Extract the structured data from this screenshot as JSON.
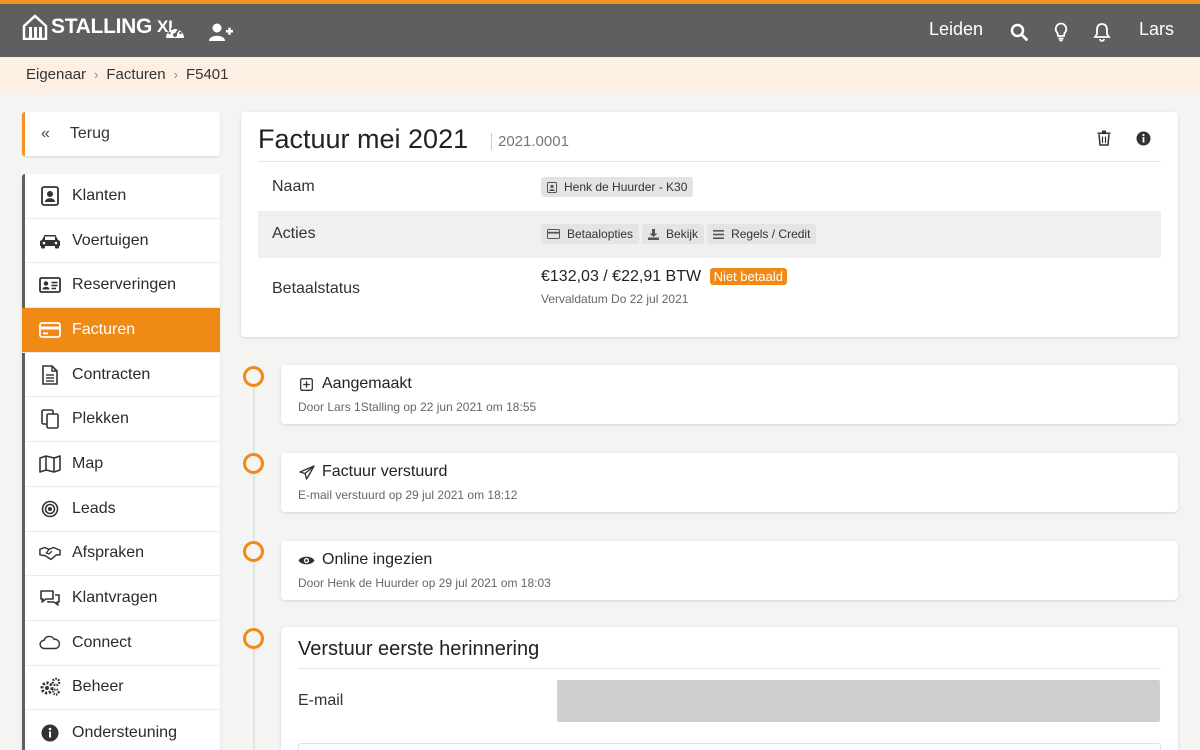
{
  "app": {
    "logo_text": "STALLING",
    "logo_suffix": "XL"
  },
  "topbar": {
    "location": "Leiden",
    "user": "Lars"
  },
  "breadcrumb": [
    "Eigenaar",
    "Facturen",
    "F5401"
  ],
  "sidebar": {
    "back_label": "Terug",
    "items": [
      {
        "label": "Klanten",
        "icon": "contact-card-icon"
      },
      {
        "label": "Voertuigen",
        "icon": "car-icon"
      },
      {
        "label": "Reserveringen",
        "icon": "id-card-icon"
      },
      {
        "label": "Facturen",
        "icon": "credit-card-icon",
        "active": true
      },
      {
        "label": "Contracten",
        "icon": "document-icon"
      },
      {
        "label": "Plekken",
        "icon": "copy-icon"
      },
      {
        "label": "Map",
        "icon": "map-icon"
      },
      {
        "label": "Leads",
        "icon": "target-icon"
      },
      {
        "label": "Afspraken",
        "icon": "handshake-icon"
      },
      {
        "label": "Klantvragen",
        "icon": "chat-icon"
      },
      {
        "label": "Connect",
        "icon": "cloud-icon"
      },
      {
        "label": "Beheer",
        "icon": "gears-icon"
      },
      {
        "label": "Ondersteuning",
        "icon": "info-icon"
      }
    ]
  },
  "invoice": {
    "title": "Factuur mei 2021",
    "number": "2021.0001",
    "rows": {
      "name_label": "Naam",
      "name_value": "Henk de Huurder - K30",
      "actions_label": "Acties",
      "actions": [
        "Betaalopties",
        "Bekijk",
        "Regels / Credit"
      ],
      "status_label": "Betaalstatus",
      "amount": "€132,03 / €22,91 BTW",
      "status_badge": "Niet betaald",
      "due": "Vervaldatum Do 22 jul 2021"
    }
  },
  "timeline": [
    {
      "title": "Aangemaakt",
      "subtitle": "Door Lars 1Stalling op 22 jun 2021 om 18:55",
      "icon": "plus-square-icon"
    },
    {
      "title": "Factuur verstuurd",
      "subtitle": "E-mail verstuurd op 29 jul 2021 om 18:12",
      "icon": "paper-plane-icon"
    },
    {
      "title": "Online ingezien",
      "subtitle": "Door Henk de Huurder op 29 jul 2021 om 18:03",
      "icon": "eye-icon"
    }
  ],
  "reminder": {
    "title": "Verstuur eerste herinnering",
    "email_label": "E-mail",
    "email_value": ""
  },
  "colors": {
    "accent": "#f08a17",
    "topbar": "#5f5f5f",
    "crumb_bg": "#fdefe2"
  }
}
